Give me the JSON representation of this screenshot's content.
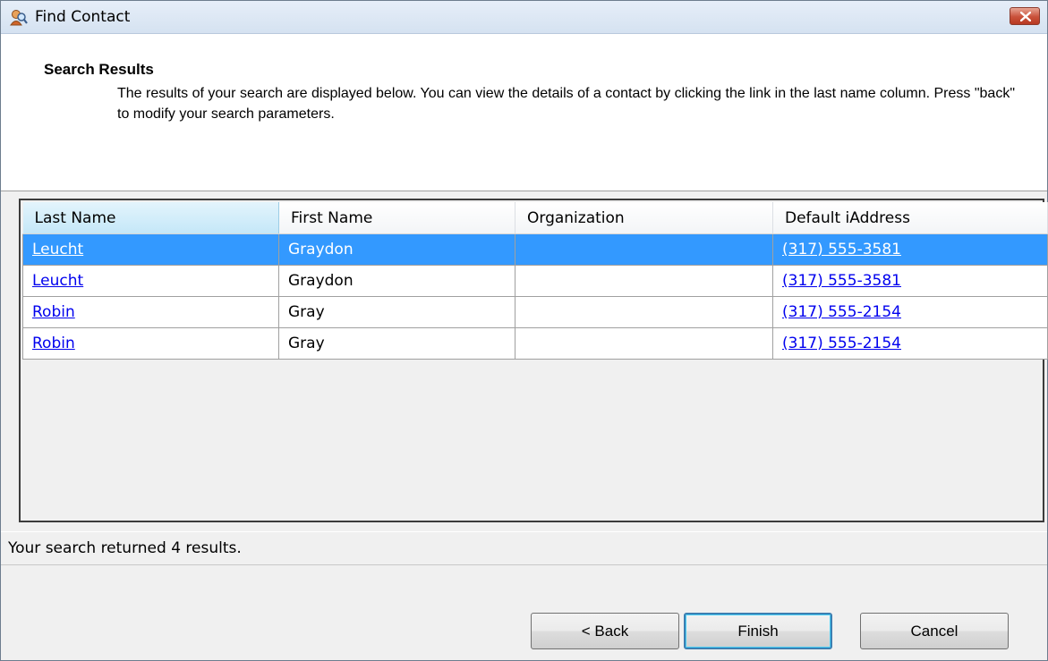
{
  "window": {
    "title": "Find Contact"
  },
  "header": {
    "section_title": "Search Results",
    "description": "The results of your search are displayed below.  You can view the details of a contact by clicking the link in the last name column.  Press \"back\" to modify your search parameters."
  },
  "table": {
    "columns": [
      "Last Name",
      "First Name",
      "Organization",
      "Default iAddress"
    ],
    "rows": [
      {
        "last_name": "Leucht",
        "first_name": "Graydon",
        "organization": "",
        "iaddress": "(317) 555-3581"
      },
      {
        "last_name": "Leucht",
        "first_name": "Graydon",
        "organization": "",
        "iaddress": "(317) 555-3581"
      },
      {
        "last_name": "Robin",
        "first_name": "Gray",
        "organization": "",
        "iaddress": "(317) 555-2154"
      },
      {
        "last_name": "Robin",
        "first_name": "Gray",
        "organization": "",
        "iaddress": "(317) 555-2154"
      }
    ],
    "selected_row_index": 0
  },
  "status": {
    "text": "Your search returned 4 results."
  },
  "buttons": {
    "back": "< Back",
    "finish": "Finish",
    "cancel": "Cancel"
  },
  "colors": {
    "selection": "#3399ff",
    "link": "#0000ee",
    "close_button": "#c9513a"
  },
  "icons": {
    "app": "find-contact-icon",
    "close": "close-icon"
  }
}
